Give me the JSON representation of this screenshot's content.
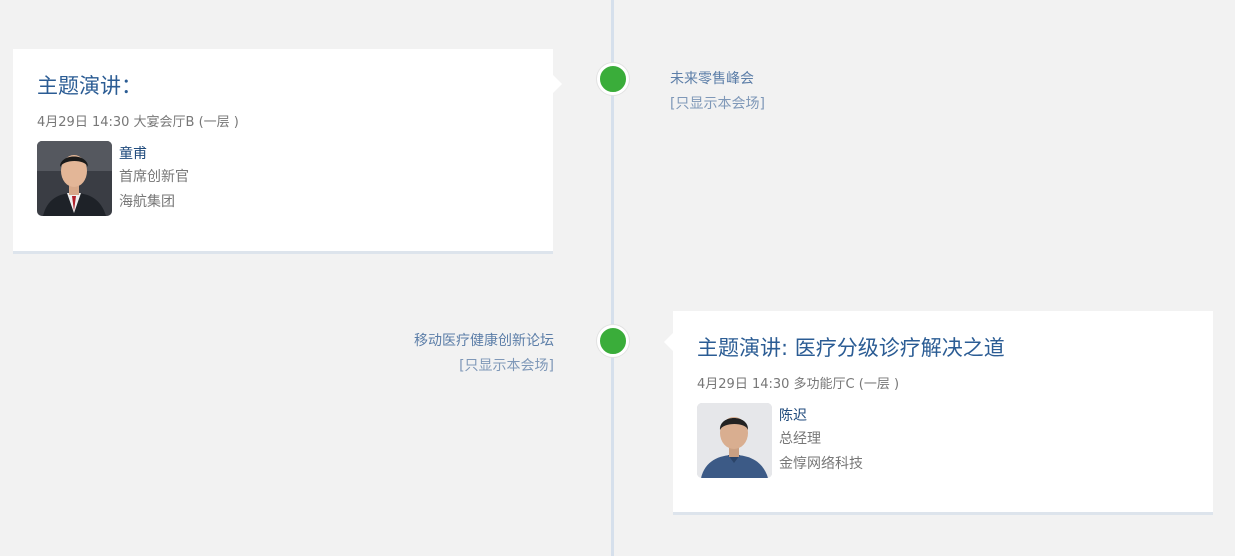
{
  "timeline": {
    "events": [
      {
        "session_name": "未来零售峰会",
        "filter_label": "[只显示本会场]",
        "title": "主题演讲：",
        "meta": "4月29日 14:30 大宴会厅B (一层 )",
        "speaker": {
          "name": "童甫",
          "title": "首席创新官",
          "company": "海航集团"
        }
      },
      {
        "session_name": "移动医疗健康创新论坛",
        "filter_label": "[只显示本会场]",
        "title": "主题演讲: 医疗分级诊疗解决之道",
        "meta": "4月29日 14:30 多功能厅C (一层 )",
        "speaker": {
          "name": "陈迟",
          "title": "总经理",
          "company": "金惇网络科技"
        }
      }
    ]
  },
  "colors": {
    "node": "#3aad3a",
    "line": "#d6e0ec",
    "title": "#2b5c94",
    "background": "#f2f2f2"
  }
}
